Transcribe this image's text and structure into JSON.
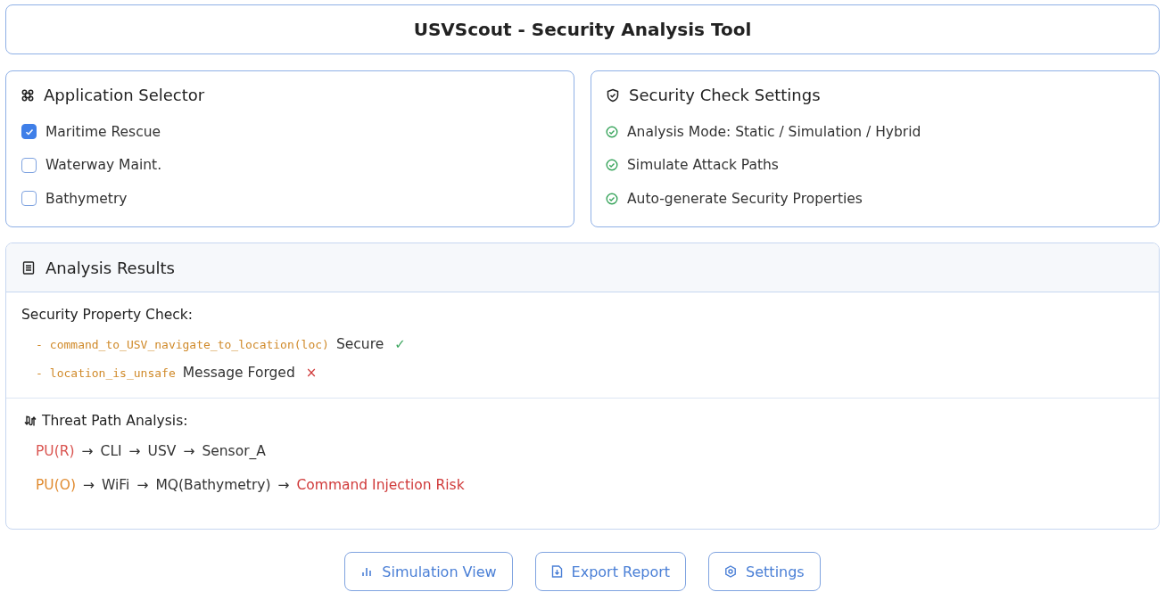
{
  "title": "USVScout - Security Analysis Tool",
  "app_selector": {
    "title": "Application Selector",
    "items": [
      {
        "label": "Maritime Rescue",
        "checked": true
      },
      {
        "label": "Waterway Maint.",
        "checked": false
      },
      {
        "label": "Bathymetry",
        "checked": false
      }
    ]
  },
  "settings": {
    "title": "Security Check Settings",
    "items": [
      {
        "label": "Analysis Mode: Static / Simulation / Hybrid",
        "checked": true
      },
      {
        "label": "Simulate Attack Paths",
        "checked": true
      },
      {
        "label": "Auto-generate Security Properties",
        "checked": true
      }
    ]
  },
  "results": {
    "title": "Analysis Results",
    "property_check": {
      "heading": "Security Property Check:",
      "items": [
        {
          "dash": "-",
          "code": "command_to_USV_navigate_to_location(loc)",
          "status": "Secure",
          "mark": "✓",
          "kind": "pass"
        },
        {
          "dash": "-",
          "code": "location_is_unsafe",
          "status": "Message Forged",
          "mark": "×",
          "kind": "fail"
        }
      ]
    },
    "threat_paths": {
      "heading": "Threat Path Analysis:",
      "paths": [
        {
          "separator": "→",
          "nodes": [
            {
              "label": "PU(R)",
              "color": "#d9534f"
            },
            {
              "label": "CLI",
              "color": "#333333"
            },
            {
              "label": "USV",
              "color": "#333333"
            },
            {
              "label": "Sensor_A",
              "color": "#333333"
            }
          ]
        },
        {
          "separator": "→",
          "nodes": [
            {
              "label": "PU(O)",
              "color": "#e08a2e"
            },
            {
              "label": "WiFi",
              "color": "#333333"
            },
            {
              "label": "MQ(Bathymetry)",
              "color": "#333333"
            },
            {
              "label": "Command Injection Risk",
              "color": "#d03a3a"
            }
          ]
        }
      ]
    }
  },
  "buttons": [
    {
      "label": "Simulation View",
      "kind": "chart"
    },
    {
      "label": "Export Report",
      "kind": "export"
    },
    {
      "label": "Settings",
      "kind": "settings"
    }
  ]
}
